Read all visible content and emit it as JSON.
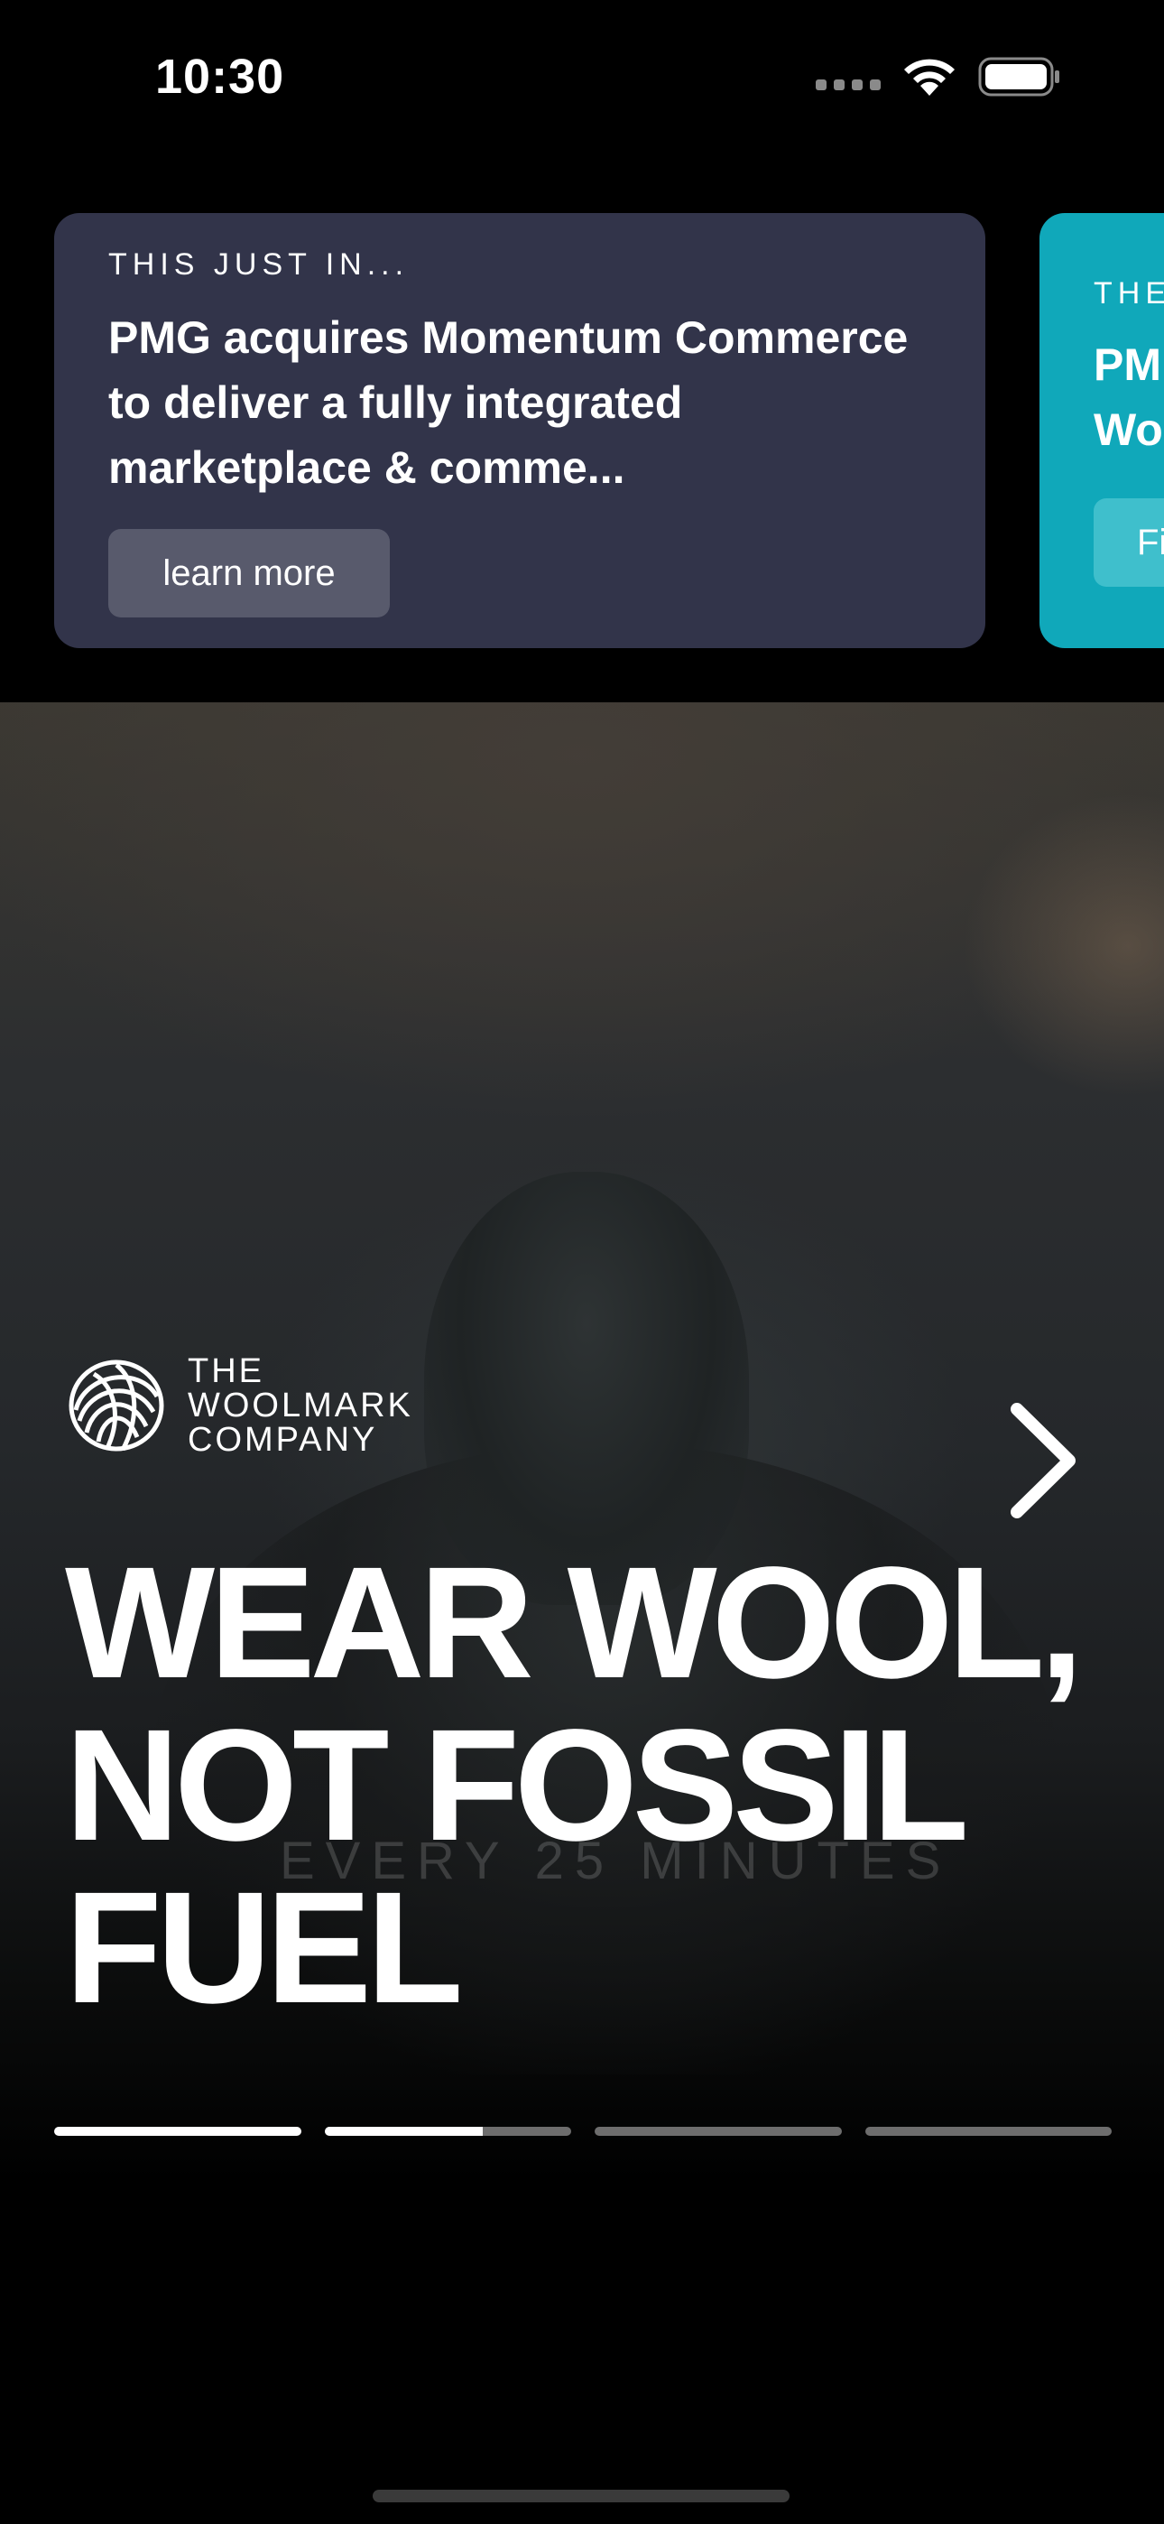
{
  "status_bar": {
    "time": "10:30",
    "icons": [
      "cellular-signal-icon",
      "wifi-icon",
      "battery-icon"
    ]
  },
  "cards": [
    {
      "eyebrow": "THIS JUST IN...",
      "headline": "PMG acquires Momentum Commerce to deliver a fully integrated marketplace & comme...",
      "button_label": "learn more",
      "background": "#32344a"
    },
    {
      "eyebrow": "THE",
      "headline": "PM\nWo",
      "button_label": "Fi",
      "background": "#10a8ba"
    }
  ],
  "hero": {
    "brand": "THE\nWOOLMARK\nCOMPANY",
    "brand_icon": "woolmark-logo-icon",
    "title": "WEAR WOOL,\nNOT FOSSIL\nFUEL",
    "subtext": "EVERY 25 MINUTES",
    "next_icon": "chevron-right-icon",
    "progress": [
      1.0,
      0.64,
      0.0,
      0.0
    ]
  },
  "colors": {
    "background": "#000000",
    "card_primary": "#32344a",
    "card_secondary": "#10a8ba",
    "button": "#585a6c"
  }
}
